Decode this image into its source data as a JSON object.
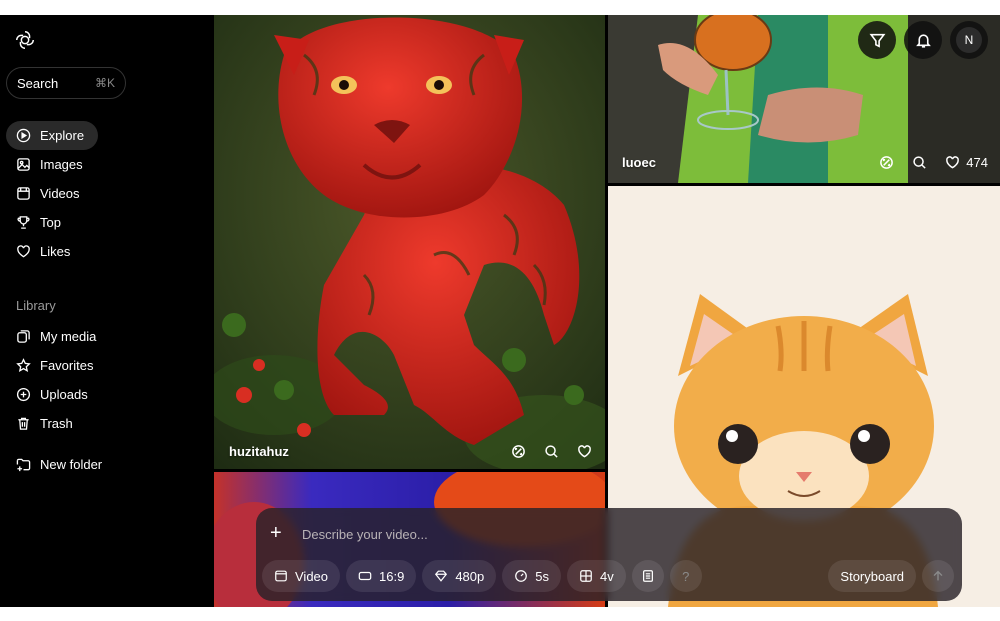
{
  "search": {
    "label": "Search",
    "shortcut": "⌘K"
  },
  "nav": [
    {
      "label": "Explore",
      "icon": "play-icon",
      "active": true
    },
    {
      "label": "Images",
      "icon": "image-icon"
    },
    {
      "label": "Videos",
      "icon": "film-icon"
    },
    {
      "label": "Top",
      "icon": "trophy-icon"
    },
    {
      "label": "Likes",
      "icon": "heart-icon"
    }
  ],
  "library": {
    "label": "Library",
    "items": [
      {
        "label": "My media",
        "icon": "media-icon"
      },
      {
        "label": "Favorites",
        "icon": "star-icon"
      },
      {
        "label": "Uploads",
        "icon": "plus-circle-icon"
      },
      {
        "label": "Trash",
        "icon": "trash-icon"
      }
    ],
    "new_folder": "New folder"
  },
  "tiles": [
    {
      "user": "huzitahuz",
      "subject": "strawberry tiger in forest"
    },
    {
      "user": "luoec",
      "likes": "474",
      "subject": "hands holding cocktail glass, green fur"
    },
    {
      "subject": "cartoon orange kitten"
    },
    {
      "subject": "red and blue abstract"
    }
  ],
  "composer": {
    "placeholder": "Describe your video...",
    "chips": [
      {
        "label": "Video",
        "icon": "video-icon"
      },
      {
        "label": "16:9",
        "icon": "aspect-icon"
      },
      {
        "label": "480p",
        "icon": "diamond-icon"
      },
      {
        "label": "5s",
        "icon": "clock-icon"
      },
      {
        "label": "4v",
        "icon": "grid-icon"
      }
    ],
    "help": "?",
    "storyboard": "Storyboard"
  },
  "header": {
    "avatar_initial": "N"
  },
  "colors": {
    "background": "#000000",
    "active_nav": "#2a2a2a",
    "accent_red": "#d3261e",
    "kitten_orange": "#f0a640"
  }
}
